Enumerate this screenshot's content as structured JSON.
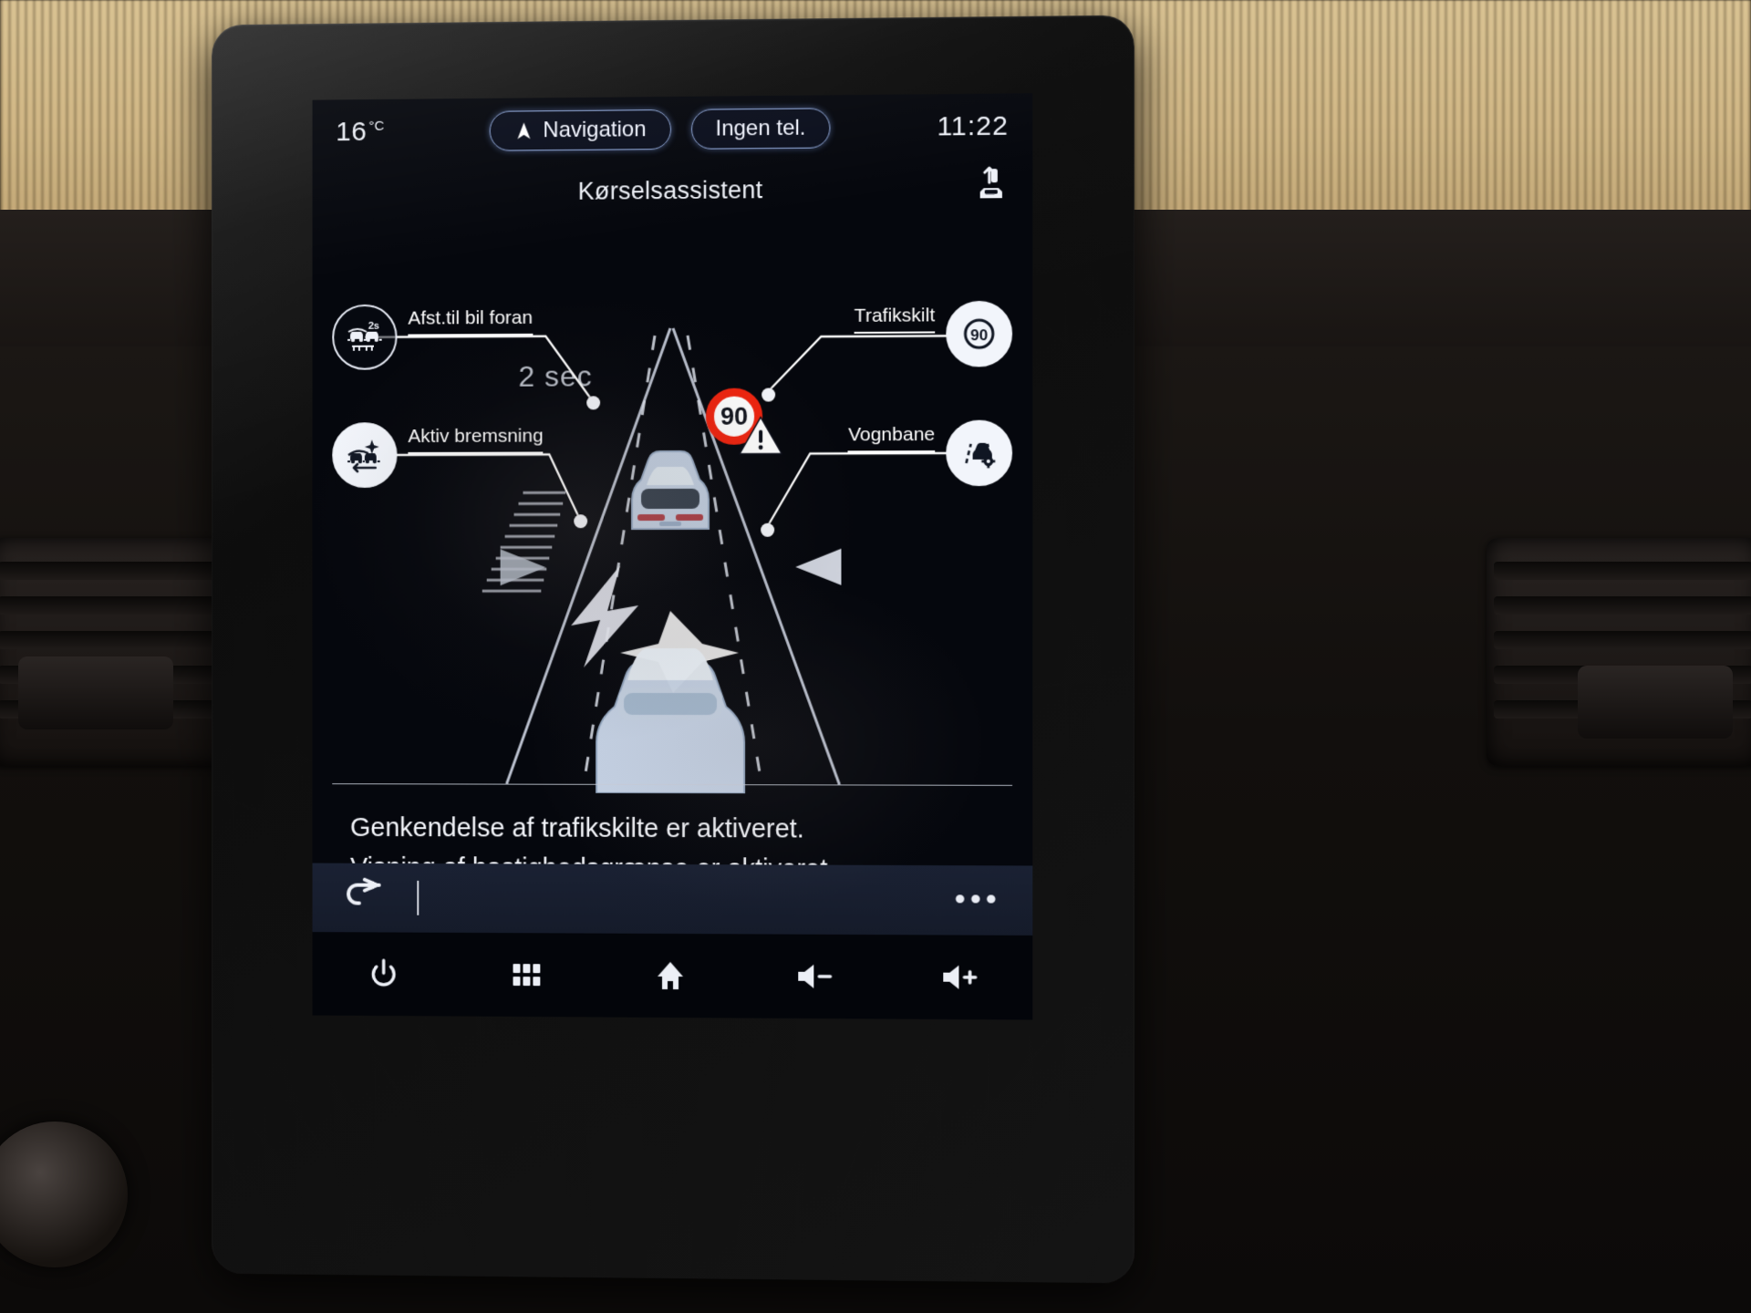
{
  "statusbar": {
    "temperature": "16",
    "temperature_unit": "°C",
    "navigation_pill": "Navigation",
    "phone_pill": "Ingen tel.",
    "clock": "11:22"
  },
  "header": {
    "title": "Kørselsassistent",
    "settings_icon": "car-settings-icon"
  },
  "callouts": {
    "distance": {
      "label": "Afst.til bil foran",
      "icon": "car-following-distance-2s-icon",
      "state": "outline"
    },
    "active_braking": {
      "label": "Aktiv bremsning",
      "icon": "active-braking-icon",
      "state": "filled"
    },
    "traffic_sign": {
      "label": "Trafikskilt",
      "icon": "speed-limit-90-sign-icon",
      "state": "filled"
    },
    "lane": {
      "label": "Vognbane",
      "icon": "lane-keep-assist-settings-icon",
      "state": "filled"
    }
  },
  "visualization": {
    "following_time": "2 sec",
    "speed_limit_value": "90",
    "speed_limit_warning_icon": "warning-triangle-icon",
    "lead_car_icon": "lead-car-icon",
    "ego_car_icon": "ego-car-icon",
    "left_arrow_icon": "lane-departure-left-arrow-icon",
    "right_arrow_icon": "lane-departure-right-arrow-icon"
  },
  "status_text": {
    "line1": "Genkendelse af trafikskilte er aktiveret.",
    "line2": "Visning af hastighedsgrænse er aktiveret."
  },
  "toolbar": {
    "back_icon": "back-arrow-icon",
    "more_label": "•••"
  },
  "hardware_bar": {
    "buttons": [
      {
        "name": "power-button",
        "icon": "power-icon"
      },
      {
        "name": "apps-button",
        "icon": "grid-apps-icon"
      },
      {
        "name": "home-button",
        "icon": "home-icon"
      },
      {
        "name": "volume-down-button",
        "icon": "volume-minus-icon"
      },
      {
        "name": "volume-up-button",
        "icon": "volume-plus-icon"
      }
    ]
  },
  "colors": {
    "accent_blue": "#8fa7d8",
    "screen_bg": "#05070d",
    "text": "#f2f5ff",
    "warning_red": "#f0240f"
  }
}
